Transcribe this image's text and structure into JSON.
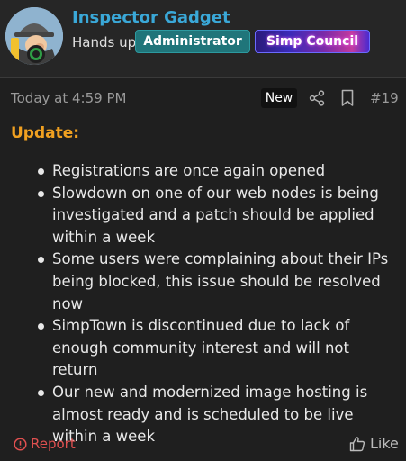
{
  "user": {
    "name": "Inspector Gadget",
    "title": "Hands up",
    "badges": [
      {
        "label": "Administrator"
      },
      {
        "label": "Simp Council"
      }
    ]
  },
  "post": {
    "timestamp": "Today at 4:59 PM",
    "new_label": "New",
    "number": "#19",
    "heading": "Update:",
    "items": [
      "Registrations are once again opened",
      "Slowdown on one of our web nodes is being investigated and a patch should be applied within a week",
      "Some users were complaining about their IPs being blocked, this issue should be resolved now",
      "SimpTown is discontinued due to lack of enough community interest and will not return",
      "Our new and modernized image hosting is almost ready and is scheduled to be live within a week"
    ]
  },
  "actions": {
    "report_label": "Report",
    "like_label": "Like"
  },
  "icons": [
    "avatar-image",
    "online-status-icon",
    "share-icon",
    "bookmark-icon",
    "report-icon",
    "thumbs-up-icon"
  ],
  "colors": {
    "username": "#3aa8d8",
    "admin_badge": "#20757a",
    "heading": "#f0a020",
    "report": "#e05050",
    "background": "#1f1f1f"
  }
}
